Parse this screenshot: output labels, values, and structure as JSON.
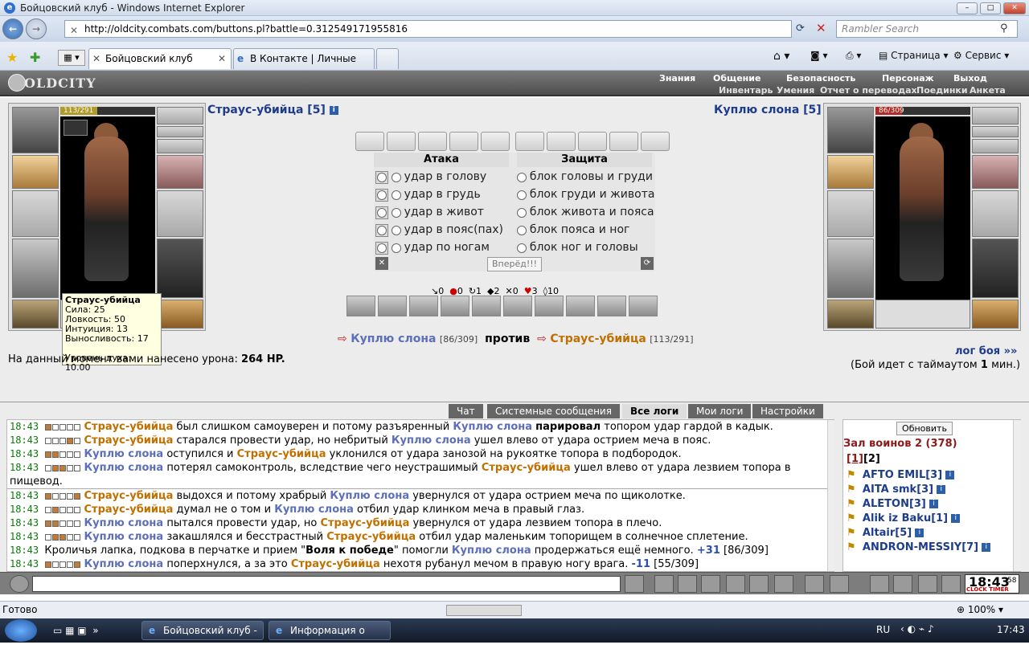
{
  "window": {
    "title": "Бойцовский клуб - Windows Internet Explorer"
  },
  "address": {
    "url": "http://oldcity.combats.com/buttons.pl?battle=0.312549171955816",
    "search_placeholder": "Rambler Search"
  },
  "tabs": [
    {
      "label": "Бойцовский клуб"
    },
    {
      "label": "В Контакте | Личные соо..."
    }
  ],
  "commands": {
    "page": "Страница",
    "service": "Сервис"
  },
  "game_menu": {
    "logo": "OLDCITY",
    "top": [
      "Знания",
      "Общение",
      "Безопасность",
      "Персонаж",
      "Выход"
    ],
    "sub": [
      "Инвентарь",
      "Умения",
      "Отчет о переводах",
      "Поединки",
      "Анкета"
    ]
  },
  "left_fighter": {
    "name": "Страус-убийца [5]",
    "hp": "113/291",
    "hp_fraction": 0.388
  },
  "right_fighter": {
    "name": "Куплю слона [5]",
    "hp": "86/309",
    "hp_fraction": 0.278
  },
  "tooltip": {
    "name": "Страус-убийца",
    "lines": [
      "Сила: 25",
      "Ловкость: 50",
      "Интуиция: 13",
      "Выносливость: 17"
    ],
    "spirit": "Уровень духа: 10.00"
  },
  "attack": {
    "header": "Атака",
    "options": [
      "удар в голову",
      "удар в грудь",
      "удар в живот",
      "удар в пояс(пах)",
      "удар по ногам"
    ]
  },
  "defense": {
    "header": "Защита",
    "options": [
      "блок головы и груди",
      "блок груди и живота",
      "блок живота и пояса",
      "блок пояса и ног",
      "блок ног и головы"
    ]
  },
  "forward_button": "Вперёд!!!",
  "stats_row": [
    "0",
    "0",
    "1",
    "2",
    "0",
    "3",
    "10"
  ],
  "versus": {
    "left": "Куплю слона",
    "left_hp": "[86/309]",
    "word": "против",
    "right": "Страус-убийца",
    "right_hp": "[113/291]"
  },
  "damage": {
    "label": "На данный момент вами нанесено урона:",
    "value": "264 HP."
  },
  "battle_log_link": "лог боя »»",
  "timeout": {
    "prefix": "(Бой идет с таймаутом",
    "value": "1",
    "suffix": "мин.)"
  },
  "chat_tabs": [
    "Чат",
    "Системные сообщения",
    "Все логи",
    "Мои логи",
    "Настройки"
  ],
  "chat_lines": [
    {
      "time": "18:43",
      "sq": [
        1,
        0,
        0,
        0,
        0
      ],
      "parts": [
        [
          "o",
          "Страус-убийца"
        ],
        [
          "t",
          " был слишком самоуверен и потому разъяренный "
        ],
        [
          "b",
          "Куплю слона"
        ],
        [
          "t",
          " "
        ],
        [
          "k",
          "парировал"
        ],
        [
          "t",
          " топором удар гардой в кадык."
        ]
      ]
    },
    {
      "time": "18:43",
      "sq": [
        0,
        0,
        0,
        1,
        0
      ],
      "parts": [
        [
          "o",
          "Страус-убийца"
        ],
        [
          "t",
          " старался провести удар, но небритый "
        ],
        [
          "b",
          "Куплю слона"
        ],
        [
          "t",
          " ушел влево от удара острием меча в пояс."
        ]
      ]
    },
    {
      "time": "18:43",
      "sq": [
        1,
        1,
        0,
        0,
        0
      ],
      "parts": [
        [
          "b",
          "Куплю слона"
        ],
        [
          "t",
          " оступился и "
        ],
        [
          "o",
          "Страус-убийца"
        ],
        [
          "t",
          " уклонился от удара занозой на рукоятке топора в подбородок."
        ]
      ]
    },
    {
      "time": "18:43",
      "sq": [
        0,
        1,
        1,
        0,
        0
      ],
      "parts": [
        [
          "b",
          "Куплю слона"
        ],
        [
          "t",
          " потерял самоконтроль, вследствие чего неустрашимый "
        ],
        [
          "o",
          "Страус-убийца"
        ],
        [
          "t",
          " ушел влево от удара лезвием топора в"
        ]
      ]
    },
    {
      "time": "",
      "sq": [],
      "parts": [
        [
          "t",
          "пищевод."
        ]
      ]
    },
    {
      "time": "18:43",
      "sq": [
        1,
        0,
        0,
        0,
        1
      ],
      "parts": [
        [
          "o",
          "Страус-убийца"
        ],
        [
          "t",
          " выдохся и потому храбрый "
        ],
        [
          "b",
          "Куплю слона"
        ],
        [
          "t",
          " увернулся от удара острием меча по щиколотке."
        ]
      ]
    },
    {
      "time": "18:43",
      "sq": [
        0,
        1,
        0,
        0,
        0
      ],
      "parts": [
        [
          "o",
          "Страус-убийца"
        ],
        [
          "t",
          " думал не о том и "
        ],
        [
          "b",
          "Куплю слона"
        ],
        [
          "t",
          " отбил удар клинком меча в правый глаз."
        ]
      ]
    },
    {
      "time": "18:43",
      "sq": [
        1,
        1,
        0,
        0,
        0
      ],
      "parts": [
        [
          "b",
          "Куплю слона"
        ],
        [
          "t",
          " пытался провести удар, но "
        ],
        [
          "o",
          "Страус-убийца"
        ],
        [
          "t",
          " увернулся от удара лезвием топора в плечо."
        ]
      ]
    },
    {
      "time": "18:43",
      "sq": [
        0,
        1,
        1,
        0,
        0
      ],
      "parts": [
        [
          "b",
          "Куплю слона"
        ],
        [
          "t",
          " закашлялся и бесстрастный "
        ],
        [
          "o",
          "Страус-убийца"
        ],
        [
          "t",
          " отбил удар маленьким топорищем в солнечное сплетение."
        ]
      ]
    },
    {
      "time": "18:43",
      "sq": [],
      "parts": [
        [
          "t",
          "Кроличья лапка, подкова в перчатке и прием \""
        ],
        [
          "k",
          "Воля к победе"
        ],
        [
          "t",
          "\" помогли "
        ],
        [
          "b",
          "Куплю слона"
        ],
        [
          "t",
          " продержаться ещё немного. "
        ],
        [
          "bl",
          "+31"
        ],
        [
          "t",
          " [86/309]"
        ]
      ]
    },
    {
      "time": "18:43",
      "sq": [
        1,
        0,
        0,
        0,
        1
      ],
      "parts": [
        [
          "b",
          "Куплю слона"
        ],
        [
          "t",
          " поперхнулся, а за это "
        ],
        [
          "o",
          "Страус-убийца"
        ],
        [
          "t",
          " нехотя рубанул мечом в правую ногу врага. "
        ],
        [
          "bl",
          "-11"
        ],
        [
          "t",
          " [55/309]"
        ]
      ]
    }
  ],
  "users_panel": {
    "refresh": "Обновить",
    "room": "Зал воинов 2 (378)",
    "pages": [
      "[1]",
      "[2]"
    ],
    "users": [
      "AFTO EMIL[3]",
      "AITA smk[3]",
      "ALETON[3]",
      "Alik iz Baku[1]",
      "Altair[5]",
      "ANDRON-MESSIY[7]"
    ]
  },
  "clock": {
    "time": "18:43",
    "sec": "58",
    "label": "CLOCK TIMER"
  },
  "status": {
    "text": "Готово",
    "zoom": "100%"
  },
  "taskbar": {
    "items": [
      "Бойцовский клуб - ...",
      "Информация о Куп..."
    ],
    "lang": "RU",
    "time": "17:43"
  }
}
